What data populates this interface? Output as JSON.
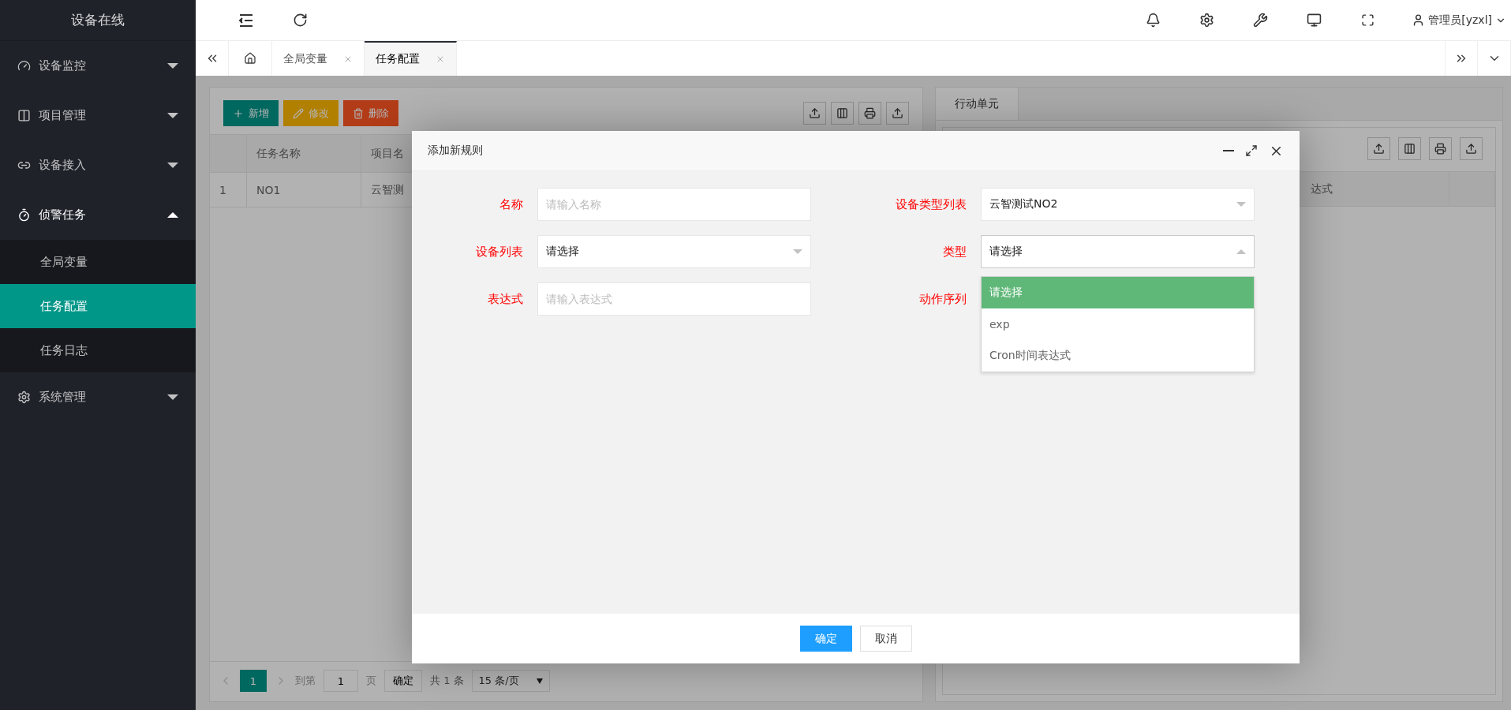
{
  "sidebar": {
    "title": "设备在线",
    "items": [
      {
        "label": "设备监控",
        "expanded": false
      },
      {
        "label": "项目管理",
        "expanded": false
      },
      {
        "label": "设备接入",
        "expanded": false
      },
      {
        "label": "侦警任务",
        "expanded": true,
        "children": [
          {
            "label": "全局变量",
            "selected": false
          },
          {
            "label": "任务配置",
            "selected": true
          },
          {
            "label": "任务日志",
            "selected": false
          }
        ]
      },
      {
        "label": "系统管理",
        "expanded": false
      }
    ]
  },
  "topbar": {
    "user": "管理员[yzxl]"
  },
  "tabs": [
    {
      "label": "全局变量",
      "selected": false
    },
    {
      "label": "任务配置",
      "selected": true
    }
  ],
  "left_panel": {
    "buttons": [
      {
        "label": "新增",
        "kind": "add"
      },
      {
        "label": "修改",
        "kind": "edit"
      },
      {
        "label": "删除",
        "kind": "delete"
      }
    ],
    "table": {
      "columns": [
        "任务名称",
        "项目名"
      ],
      "rows": [
        {
          "index": "1",
          "cells": [
            "NO1",
            "云智测"
          ]
        }
      ]
    },
    "pagination": {
      "current": "1",
      "goto_label": "到第",
      "page_value": "1",
      "page_unit": "页",
      "confirm": "确定",
      "total": "共 1 条",
      "page_size": "15 条/页"
    }
  },
  "right_panel": {
    "tab": "行动单元",
    "table": {
      "columns": [
        "达式"
      ]
    }
  },
  "dialog": {
    "title": "添加新规则",
    "rows": [
      {
        "fields": [
          {
            "label": "名称",
            "kind": "input",
            "placeholder": "请输入名称"
          },
          {
            "label": "设备类型列表",
            "kind": "select",
            "value": "云智测试NO2",
            "open": false
          }
        ]
      },
      {
        "fields": [
          {
            "label": "设备列表",
            "kind": "select",
            "value": "请选择",
            "open": false
          },
          {
            "label": "类型",
            "kind": "select",
            "value": "请选择",
            "open": true,
            "options": [
              {
                "label": "请选择",
                "selected": true
              },
              {
                "label": "exp",
                "selected": false
              },
              {
                "label": "Cron时间表达式",
                "selected": false
              }
            ]
          }
        ]
      },
      {
        "fields": [
          {
            "label": "表达式",
            "kind": "input",
            "placeholder": "请输入表达式"
          },
          {
            "label": "动作序列",
            "kind": "covered"
          }
        ]
      }
    ],
    "buttons": [
      {
        "label": "确定",
        "kind": "primary"
      },
      {
        "label": "取消",
        "kind": "default"
      }
    ]
  }
}
